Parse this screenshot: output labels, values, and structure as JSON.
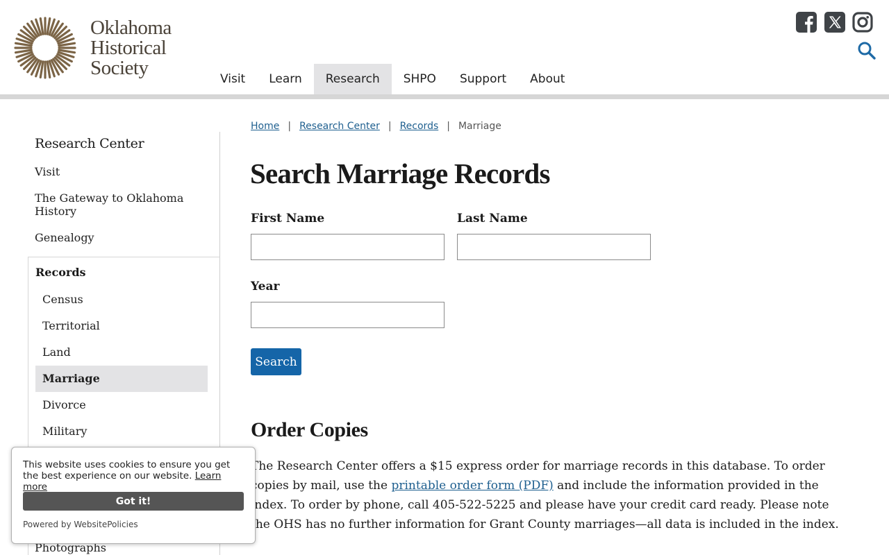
{
  "header": {
    "logo_lines": [
      "Oklahoma",
      "Historical",
      "Society"
    ],
    "brand_color": "#7b6446",
    "nav": [
      {
        "label": "Visit",
        "active": false
      },
      {
        "label": "Learn",
        "active": false
      },
      {
        "label": "Research",
        "active": true
      },
      {
        "label": "SHPO",
        "active": false
      },
      {
        "label": "Support",
        "active": false
      },
      {
        "label": "About",
        "active": false
      }
    ],
    "social_icons": [
      "facebook-icon",
      "x-icon",
      "instagram-icon"
    ],
    "search_icon": "search-icon"
  },
  "sidebar": {
    "title": "Research Center",
    "links": [
      {
        "label": "Visit"
      },
      {
        "label": "The Gateway to Oklahoma History"
      },
      {
        "label": "Genealogy"
      }
    ],
    "records": {
      "title": "Records",
      "items": [
        {
          "label": "Census",
          "active": false
        },
        {
          "label": "Territorial",
          "active": false
        },
        {
          "label": "Land",
          "active": false
        },
        {
          "label": "Marriage",
          "active": true
        },
        {
          "label": "Divorce",
          "active": false
        },
        {
          "label": "Military",
          "active": false
        }
      ]
    },
    "photographs": "Photographs"
  },
  "breadcrumb": {
    "items": [
      "Home",
      "Research Center",
      "Records"
    ],
    "current": "Marriage",
    "separator": "|"
  },
  "main": {
    "title": "Search Marriage Records",
    "form": {
      "first_name_label": "First Name",
      "first_name_value": "",
      "last_name_label": "Last Name",
      "last_name_value": "",
      "year_label": "Year",
      "year_value": "",
      "submit_label": "Search"
    },
    "order": {
      "title": "Order Copies",
      "text_1": "The Research Center offers a $15 express order for marriage records in this database. To order copies by mail, use the ",
      "link_text": "printable order form (PDF)",
      "text_2": " and include the information provided in the index. To order by phone, call 405-522-5225 and please have your credit card ready. Please note the OHS has no further information for Grant County marriages—all data is included in the index."
    },
    "accent_color": "#1565a8"
  },
  "cookie_banner": {
    "message": "This website uses cookies to ensure you get the best experience on our website.",
    "learn_more": "Learn more",
    "accept_label": "Got it!",
    "powered_by": "Powered by WebsitePolicies"
  }
}
